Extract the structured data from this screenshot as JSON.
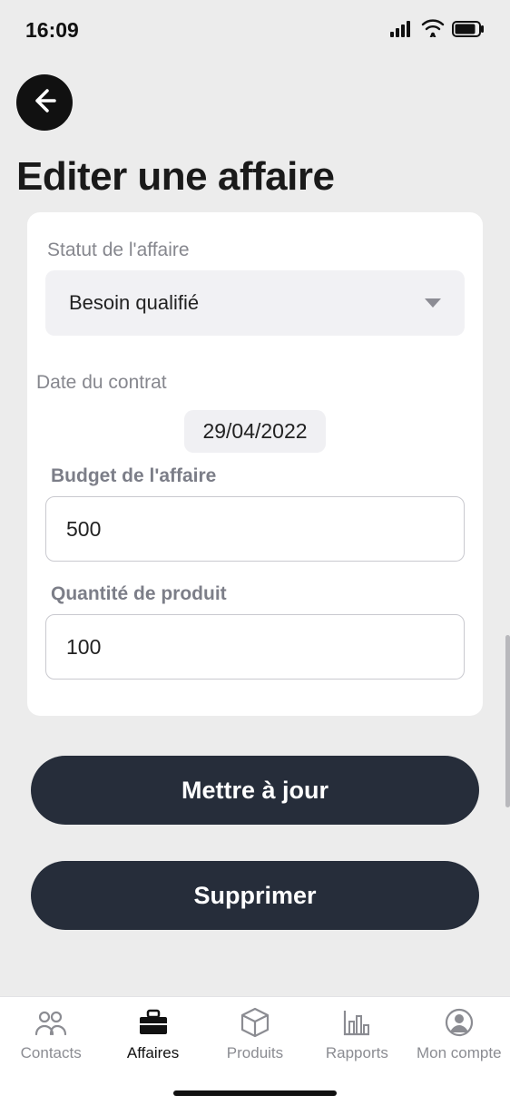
{
  "status": {
    "time": "16:09"
  },
  "header": {
    "title": "Editer une affaire"
  },
  "form": {
    "status_label": "Statut de l'affaire",
    "status_value": "Besoin qualifié",
    "date_label": "Date du contrat",
    "date_value": "29/04/2022",
    "budget_label": "Budget de l'affaire",
    "budget_value": "500",
    "quantity_label": "Quantité de produit",
    "quantity_value": "100"
  },
  "buttons": {
    "update": "Mettre à jour",
    "delete": "Supprimer"
  },
  "tabs": {
    "contacts": "Contacts",
    "affaires": "Affaires",
    "produits": "Produits",
    "rapports": "Rapports",
    "compte": "Mon compte"
  }
}
